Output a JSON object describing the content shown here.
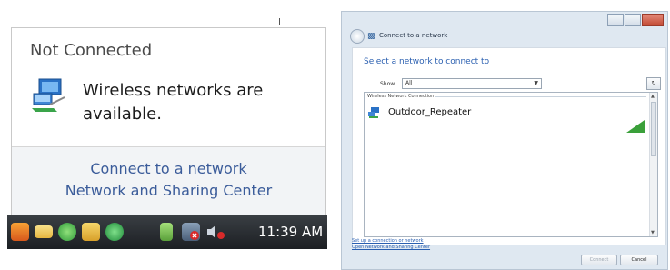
{
  "tray_popup": {
    "title": "Not Connected",
    "message": "Wireless networks are available.",
    "connect_link": "Connect to a network",
    "sharing_link": "Network and Sharing Center"
  },
  "taskbar": {
    "clock": "11:39 AM",
    "icons": [
      "office-icon",
      "mail-icon",
      "messenger-icon",
      "calendar-icon",
      "update-icon",
      "device-icon",
      "network-disconnected-icon",
      "volume-icon"
    ]
  },
  "dialog": {
    "title": "Connect to a network",
    "heading": "Select a network to connect to",
    "show_label": "Show",
    "show_value": "All",
    "group_header": "Wireless Network Connection",
    "networks": [
      {
        "name": "Outdoor_Repeater"
      }
    ],
    "link_setup": "Set up a connection or network",
    "link_sharing": "Open Network and Sharing Center",
    "connect_button": "Connect",
    "cancel_button": "Cancel"
  },
  "colors": {
    "link": "#3b5c9a",
    "dialog_heading": "#2a5fb0",
    "taskbar": "#2a2e33",
    "signal": "#3aa03a"
  }
}
